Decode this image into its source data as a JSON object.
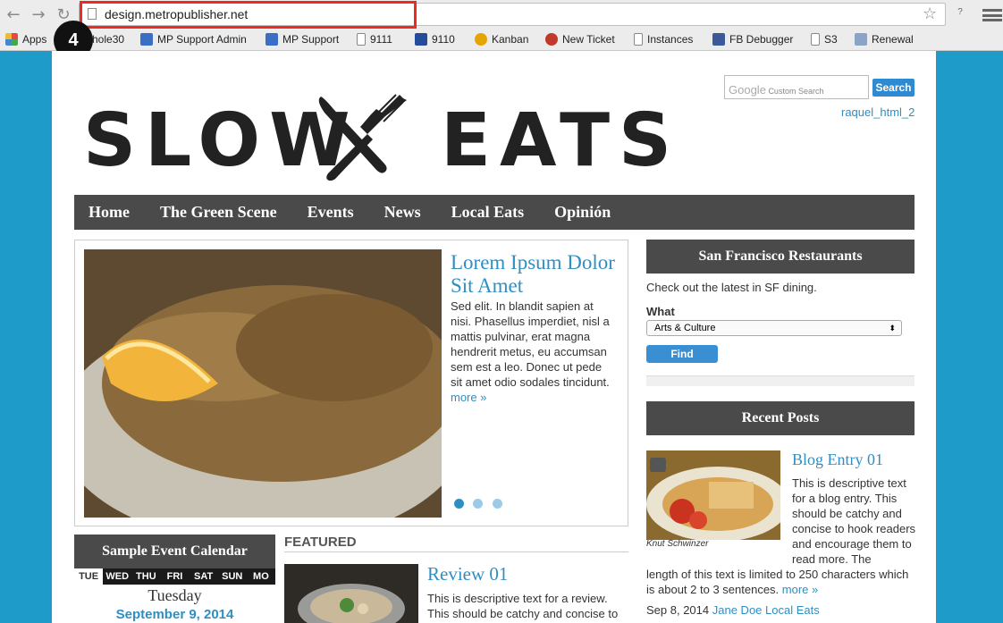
{
  "browser": {
    "url": "design.metropublisher.net",
    "bookmarks": [
      "Apps",
      "hole30",
      "MP Support Admin",
      "MP Support",
      "9111",
      "9110",
      "Kanban",
      "New Ticket",
      "Instances",
      "FB Debugger",
      "S3",
      "Renewal"
    ],
    "step_badge": "4"
  },
  "site": {
    "logo_left": "SLOW",
    "logo_right": "EATS",
    "search_placeholder_brand": "Google",
    "search_placeholder": "Custom Search",
    "search_button": "Search",
    "user": "raquel_html_2",
    "nav": [
      "Home",
      "The Green Scene",
      "Events",
      "News",
      "Local Eats",
      "Opinión"
    ]
  },
  "slider": {
    "title": "Lorem Ipsum Dolor Sit Amet",
    "text": "Sed elit. In blandit sapien at nisi. Phasellus imperdiet, nisl a mattis pulvinar, erat magna hendrerit metus, eu accumsan sem est a leo. Donec ut pede sit amet odio sodales tincidunt.",
    "more": "more »"
  },
  "restaurants": {
    "title": "San Francisco Restaurants",
    "intro": "Check out the latest in SF dining.",
    "what_label": "What",
    "selected": "Arts & Culture",
    "find": "Find"
  },
  "recent": {
    "title": "Recent Posts",
    "post_title": "Blog Entry 01",
    "post_text": "This is descriptive text for a blog entry. This should be catchy and concise to hook readers and encourage them to read more. The length of this text is limited to 250 characters which is about 2 to 3 sentences.",
    "post_text_a": "This is descriptive text for a blog entry. This should be catchy and concise to hook readers and encourage them to read more. The",
    "post_text_b": "length of this text is limited to 250 characters which is about 2 to 3 sentences.",
    "more": "more »",
    "caption": "Knut Schwinzer",
    "date": "Sep 8, 2014",
    "author": "Jane Doe Local Eats"
  },
  "calendar": {
    "title": "Sample Event Calendar",
    "days": [
      "TUE",
      "WED",
      "THU",
      "FRI",
      "SAT",
      "SUN",
      "MO"
    ],
    "weekday": "Tuesday",
    "date": "September 9, 2014"
  },
  "featured": {
    "label": "FEATURED",
    "review_title": "Review 01",
    "review_text": "This is descriptive text for a review. This should be catchy and concise to"
  }
}
